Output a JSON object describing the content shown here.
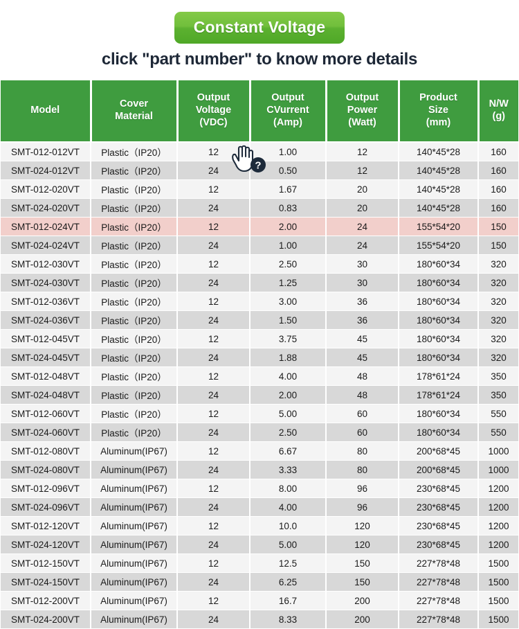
{
  "banner": {
    "label": "Constant Voltage",
    "bg_color_top": "#83c947",
    "bg_color_bottom": "#4fa827",
    "text_color": "#ffffff"
  },
  "subtitle": {
    "text": "click \"part number\" to know more details",
    "color": "#1d2736"
  },
  "cursor": {
    "icon": "hand-pointer-help-cursor",
    "badge": "?"
  },
  "table": {
    "header_bg": "#3f9c3f",
    "row_odd_bg": "#f4f4f4",
    "row_even_bg": "#d8d8d8",
    "row_highlight_bg": "#f2cfcb",
    "columns": [
      {
        "key": "model",
        "lines": [
          "Model"
        ]
      },
      {
        "key": "cover",
        "lines": [
          "Cover",
          "Material"
        ]
      },
      {
        "key": "voltage",
        "lines": [
          "Output",
          "Voltage",
          "(VDC)"
        ]
      },
      {
        "key": "current",
        "lines": [
          "Output",
          "CVurrent",
          "(Amp)"
        ]
      },
      {
        "key": "power",
        "lines": [
          "Output",
          "Power",
          "(Watt)"
        ]
      },
      {
        "key": "size",
        "lines": [
          "Product",
          "Size",
          "(mm)"
        ]
      },
      {
        "key": "nw",
        "lines": [
          "N/W",
          "(g)"
        ]
      }
    ],
    "rows": [
      {
        "model": "SMT-012-012VT",
        "cover": "Plastic（IP20）",
        "voltage": "12",
        "current": "1.00",
        "power": "12",
        "size": "140*45*28",
        "nw": "160",
        "highlight": false
      },
      {
        "model": "SMT-024-012VT",
        "cover": "Plastic（IP20）",
        "voltage": "24",
        "current": "0.50",
        "power": "12",
        "size": "140*45*28",
        "nw": "160",
        "highlight": false
      },
      {
        "model": "SMT-012-020VT",
        "cover": "Plastic（IP20）",
        "voltage": "12",
        "current": "1.67",
        "power": "20",
        "size": "140*45*28",
        "nw": "160",
        "highlight": false
      },
      {
        "model": "SMT-024-020VT",
        "cover": "Plastic（IP20）",
        "voltage": "24",
        "current": "0.83",
        "power": "20",
        "size": "140*45*28",
        "nw": "160",
        "highlight": false
      },
      {
        "model": "SMT-012-024VT",
        "cover": "Plastic（IP20）",
        "voltage": "12",
        "current": "2.00",
        "power": "24",
        "size": "155*54*20",
        "nw": "150",
        "highlight": true
      },
      {
        "model": "SMT-024-024VT",
        "cover": "Plastic（IP20）",
        "voltage": "24",
        "current": "1.00",
        "power": "24",
        "size": "155*54*20",
        "nw": "150",
        "highlight": false
      },
      {
        "model": "SMT-012-030VT",
        "cover": "Plastic（IP20）",
        "voltage": "12",
        "current": "2.50",
        "power": "30",
        "size": "180*60*34",
        "nw": "320",
        "highlight": false
      },
      {
        "model": "SMT-024-030VT",
        "cover": "Plastic（IP20）",
        "voltage": "24",
        "current": "1.25",
        "power": "30",
        "size": "180*60*34",
        "nw": "320",
        "highlight": false
      },
      {
        "model": "SMT-012-036VT",
        "cover": "Plastic（IP20）",
        "voltage": "12",
        "current": "3.00",
        "power": "36",
        "size": "180*60*34",
        "nw": "320",
        "highlight": false
      },
      {
        "model": "SMT-024-036VT",
        "cover": "Plastic（IP20）",
        "voltage": "24",
        "current": "1.50",
        "power": "36",
        "size": "180*60*34",
        "nw": "320",
        "highlight": false
      },
      {
        "model": "SMT-012-045VT",
        "cover": "Plastic（IP20）",
        "voltage": "12",
        "current": "3.75",
        "power": "45",
        "size": "180*60*34",
        "nw": "320",
        "highlight": false
      },
      {
        "model": "SMT-024-045VT",
        "cover": "Plastic（IP20）",
        "voltage": "24",
        "current": "1.88",
        "power": "45",
        "size": "180*60*34",
        "nw": "320",
        "highlight": false
      },
      {
        "model": "SMT-012-048VT",
        "cover": "Plastic（IP20）",
        "voltage": "12",
        "current": "4.00",
        "power": "48",
        "size": "178*61*24",
        "nw": "350",
        "highlight": false
      },
      {
        "model": "SMT-024-048VT",
        "cover": "Plastic（IP20）",
        "voltage": "24",
        "current": "2.00",
        "power": "48",
        "size": "178*61*24",
        "nw": "350",
        "highlight": false
      },
      {
        "model": "SMT-012-060VT",
        "cover": "Plastic（IP20）",
        "voltage": "12",
        "current": "5.00",
        "power": "60",
        "size": "180*60*34",
        "nw": "550",
        "highlight": false
      },
      {
        "model": "SMT-024-060VT",
        "cover": "Plastic（IP20）",
        "voltage": "24",
        "current": "2.50",
        "power": "60",
        "size": "180*60*34",
        "nw": "550",
        "highlight": false
      },
      {
        "model": "SMT-012-080VT",
        "cover": "Aluminum(IP67)",
        "voltage": "12",
        "current": "6.67",
        "power": "80",
        "size": "200*68*45",
        "nw": "1000",
        "highlight": false
      },
      {
        "model": "SMT-024-080VT",
        "cover": "Aluminum(IP67)",
        "voltage": "24",
        "current": "3.33",
        "power": "80",
        "size": "200*68*45",
        "nw": "1000",
        "highlight": false
      },
      {
        "model": "SMT-012-096VT",
        "cover": "Aluminum(IP67)",
        "voltage": "12",
        "current": "8.00",
        "power": "96",
        "size": "230*68*45",
        "nw": "1200",
        "highlight": false
      },
      {
        "model": "SMT-024-096VT",
        "cover": "Aluminum(IP67)",
        "voltage": "24",
        "current": "4.00",
        "power": "96",
        "size": "230*68*45",
        "nw": "1200",
        "highlight": false
      },
      {
        "model": "SMT-012-120VT",
        "cover": "Aluminum(IP67)",
        "voltage": "12",
        "current": "10.0",
        "power": "120",
        "size": "230*68*45",
        "nw": "1200",
        "highlight": false
      },
      {
        "model": "SMT-024-120VT",
        "cover": "Aluminum(IP67)",
        "voltage": "24",
        "current": "5.00",
        "power": "120",
        "size": "230*68*45",
        "nw": "1200",
        "highlight": false
      },
      {
        "model": "SMT-012-150VT",
        "cover": "Aluminum(IP67)",
        "voltage": "12",
        "current": "12.5",
        "power": "150",
        "size": "227*78*48",
        "nw": "1500",
        "highlight": false
      },
      {
        "model": "SMT-024-150VT",
        "cover": "Aluminum(IP67)",
        "voltage": "24",
        "current": "6.25",
        "power": "150",
        "size": "227*78*48",
        "nw": "1500",
        "highlight": false
      },
      {
        "model": "SMT-012-200VT",
        "cover": "Aluminum(IP67)",
        "voltage": "12",
        "current": "16.7",
        "power": "200",
        "size": "227*78*48",
        "nw": "1500",
        "highlight": false
      },
      {
        "model": "SMT-024-200VT",
        "cover": "Aluminum(IP67)",
        "voltage": "24",
        "current": "8.33",
        "power": "200",
        "size": "227*78*48",
        "nw": "1500",
        "highlight": false
      }
    ]
  }
}
